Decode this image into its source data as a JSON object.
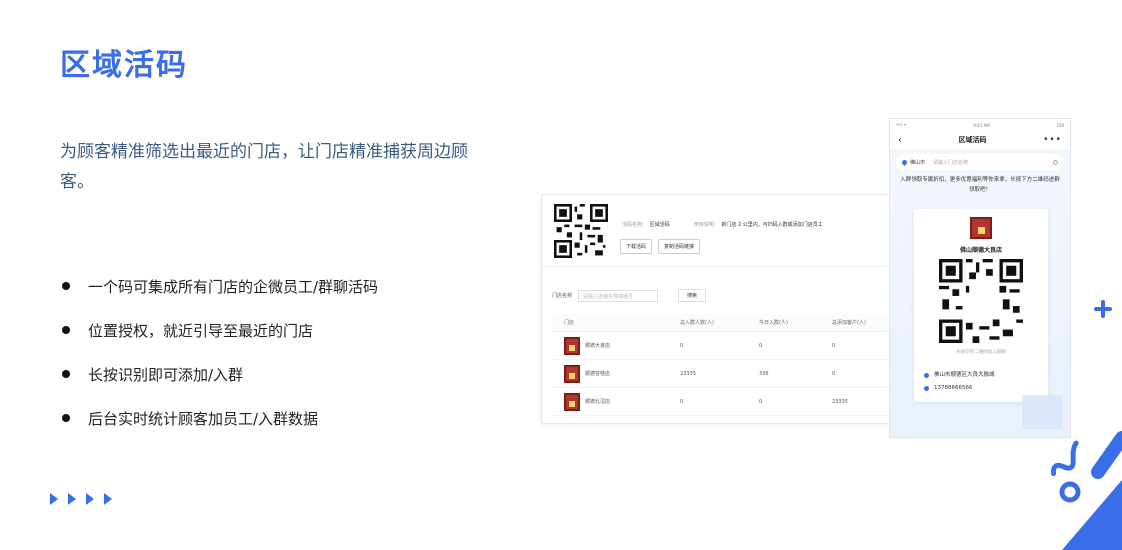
{
  "page": {
    "title": "区域活码",
    "intro": "为顾客精准筛选出最近的门店，让门店精准捕获周边顾客。",
    "bullets": [
      "一个码可集成所有门店的企微员工/群聊活码",
      "位置授权，就近引导至最近的门店",
      "长按识别即可添加/入群",
      "后台实时统计顾客加员工/入群数据"
    ]
  },
  "admin": {
    "meta": {
      "name_key": "活码名称:",
      "name_value": "区域活码",
      "desc_key": "使用说明:",
      "desc_value": "新门店 2 公里内，可扫码入群或添加门店员工"
    },
    "buttons": {
      "download": "下载活码",
      "copy_link": "复制活码链接"
    },
    "search": {
      "label": "门店名称",
      "placeholder": "请输入店铺名称或编号",
      "query": "搜索"
    },
    "columns": [
      "门店",
      "总入群人数(人)",
      "今日入群(人)",
      "总添加客户(人)"
    ],
    "rows": [
      {
        "store": "顺德大良店",
        "total": "0",
        "today": "0",
        "added": "0"
      },
      {
        "store": "顺德容桂店",
        "total": "23335",
        "today": "336",
        "added": "0"
      },
      {
        "store": "顺德北滘店",
        "total": "0",
        "today": "0",
        "added": "23335"
      }
    ]
  },
  "phone": {
    "status": {
      "signal": "•ııl ᯤ",
      "time": "9:41 AM",
      "battery": "100"
    },
    "nav_title": "区域活码",
    "search": {
      "city": "佛山市",
      "placeholder": "请输入门店名称"
    },
    "notice": "入群领取专属折扣，更多优惠福利等你来拿，长按下方二维码进群领取吧！",
    "store_name": "佛山顺德大良店",
    "hint": "长按识别二维码加入群聊",
    "address": "佛山市顺德区大良大融城",
    "phone": "13788666566"
  },
  "colors": {
    "accent": "#3a6ee8",
    "text_blue": "#3d5a80"
  },
  "icons": [
    "arrow-right-icon",
    "plus-icon",
    "location-icon",
    "phone-icon",
    "search-icon",
    "back-icon",
    "more-icon"
  ]
}
